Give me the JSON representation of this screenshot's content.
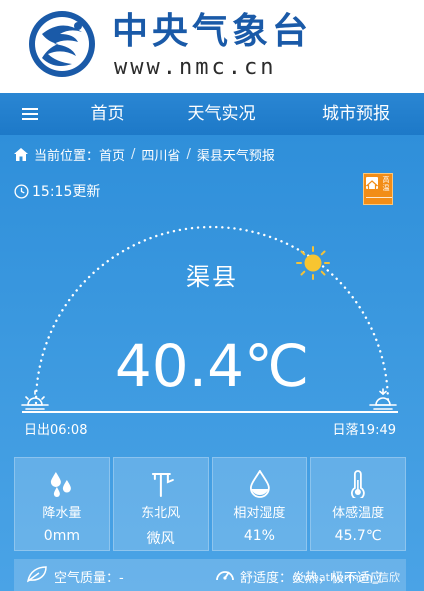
{
  "header": {
    "title": "中央气象台",
    "url": "www.nmc.cn",
    "brand_color": "#1a5aa8"
  },
  "nav": {
    "menu_icon": "menu-icon",
    "items": [
      {
        "label": "首页"
      },
      {
        "label": "天气实况"
      },
      {
        "label": "城市预报"
      }
    ]
  },
  "breadcrumb": {
    "icon": "home-icon",
    "prefix": "当前位置：",
    "items": [
      "首页",
      "四川省",
      "渠县天气预报"
    ],
    "separator": "/"
  },
  "update_time": "15:15更新",
  "warning": {
    "label": "高温",
    "color": "#f28d17",
    "sub": "HEAT WAVE"
  },
  "weather": {
    "city": "渠县",
    "temperature": "40.4℃",
    "sunrise": "日出06:08",
    "sunset": "日落19:49",
    "sun_progress": 0.67
  },
  "cards": [
    {
      "icon": "raindrops-icon",
      "label": "降水量",
      "value": "0mm"
    },
    {
      "icon": "wind-vane-icon",
      "label": "东北风",
      "value": "微风"
    },
    {
      "icon": "humidity-drop-icon",
      "label": "相对湿度",
      "value": "41%"
    },
    {
      "icon": "thermometer-icon",
      "label": "体感温度",
      "value": "45.7℃"
    }
  ],
  "bottom": {
    "air_quality": "空气质量：-",
    "comfort": "舒适度：炎热，极不适应",
    "watermark": "@weatherman_信欣"
  }
}
